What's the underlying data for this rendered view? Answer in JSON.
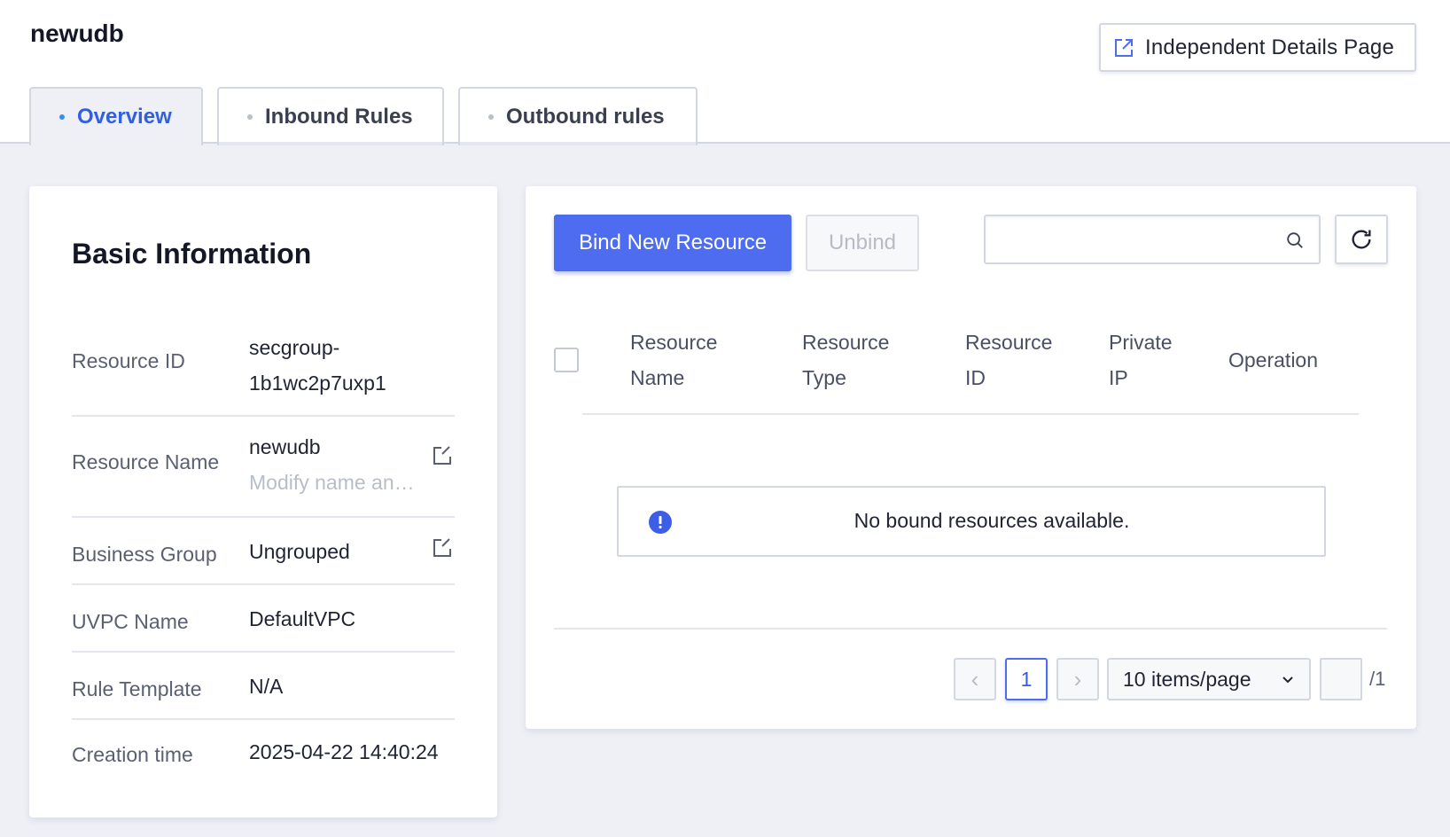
{
  "header": {
    "title": "newudb",
    "independent_details_label": "Independent Details Page"
  },
  "tabs": [
    {
      "label": "Overview",
      "active": true
    },
    {
      "label": "Inbound Rules",
      "active": false
    },
    {
      "label": "Outbound rules",
      "active": false
    }
  ],
  "basic_info": {
    "title": "Basic Information",
    "rows": [
      {
        "label": "Resource ID",
        "value_line1": "secgroup-",
        "value_line2": "1b1wc2p7uxp1"
      },
      {
        "label": "Resource Name",
        "value_line1": "newudb",
        "value_line2": "Modify name an…"
      },
      {
        "label": "Business Group",
        "value": "Ungrouped"
      },
      {
        "label": "UVPC Name",
        "value": "DefaultVPC"
      },
      {
        "label": "Rule Template",
        "value": "N/A"
      },
      {
        "label": "Creation time",
        "value": "2025-04-22 14:40:24"
      }
    ]
  },
  "resources": {
    "bind_label": "Bind New Resource",
    "unbind_label": "Unbind",
    "search": {
      "value": "",
      "placeholder": ""
    },
    "columns": [
      {
        "line1": "Resource",
        "line2": "Name"
      },
      {
        "line1": "Resource",
        "line2": "Type"
      },
      {
        "line1": "Resource",
        "line2": "ID"
      },
      {
        "line1": "Private",
        "line2": "IP"
      },
      {
        "line1": "Operation",
        "line2": ""
      }
    ],
    "empty_message": "No bound resources available."
  },
  "pagination": {
    "prev": "‹",
    "next": "›",
    "current_page": "1",
    "page_size_label": "10 items/page",
    "total_pages_label": "/1"
  },
  "colors": {
    "accent": "#4d6cf0",
    "active_tab_text": "#3060e0",
    "page_background": "#eef0f6"
  }
}
